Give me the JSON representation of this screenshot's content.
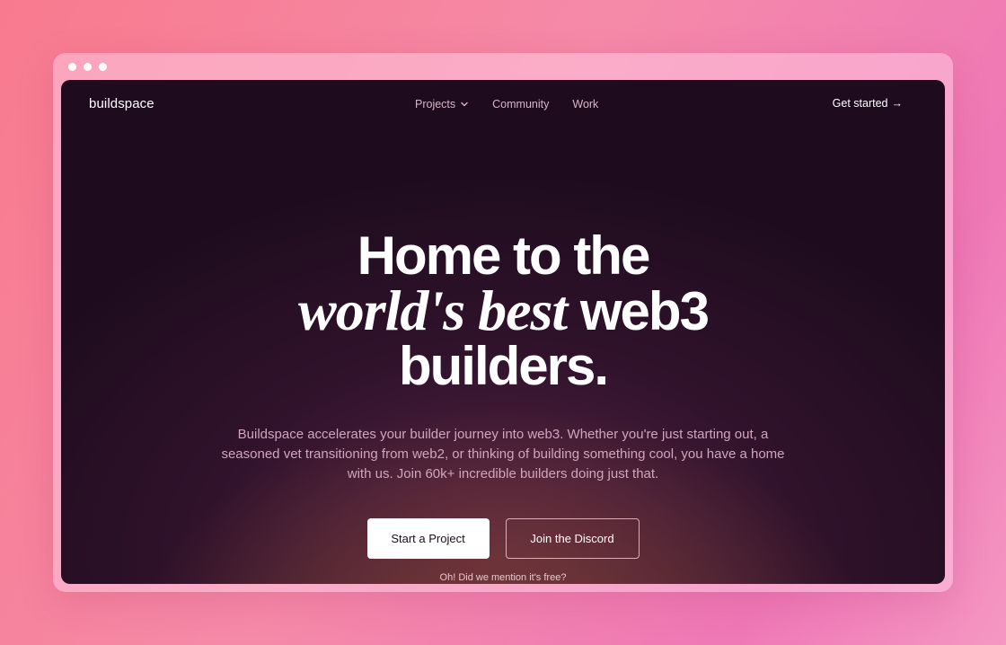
{
  "window": {
    "dots": [
      "dot",
      "dot",
      "dot"
    ]
  },
  "nav": {
    "logo": "buildspace",
    "items": [
      {
        "label": "Projects",
        "has_dropdown": true,
        "icon": "chevron-down-icon"
      },
      {
        "label": "Community"
      },
      {
        "label": "Work"
      }
    ],
    "cta_label": "Get started",
    "cta_icon": "→"
  },
  "hero": {
    "line1": "Home to the",
    "line2_serif": "world's best",
    "line2_rest": " web3",
    "line3": "builders.",
    "subtitle": "Buildspace accelerates your builder journey into web3. Whether you're just starting out, a seasoned vet transitioning from web2, or thinking of building something cool, you have a home with us. Join 60k+ incredible builders doing just that."
  },
  "actions": {
    "primary_label": "Start a Project",
    "secondary_label": "Join the Discord",
    "note": "Oh! Did we mention it's free?"
  },
  "colors": {
    "background_gradient_start": "#f87a8e",
    "background_gradient_end": "#ef78b6",
    "screen_bg": "#1e0c1e",
    "glow": "#a05a32",
    "nav_muted": "#d9b3c8"
  }
}
